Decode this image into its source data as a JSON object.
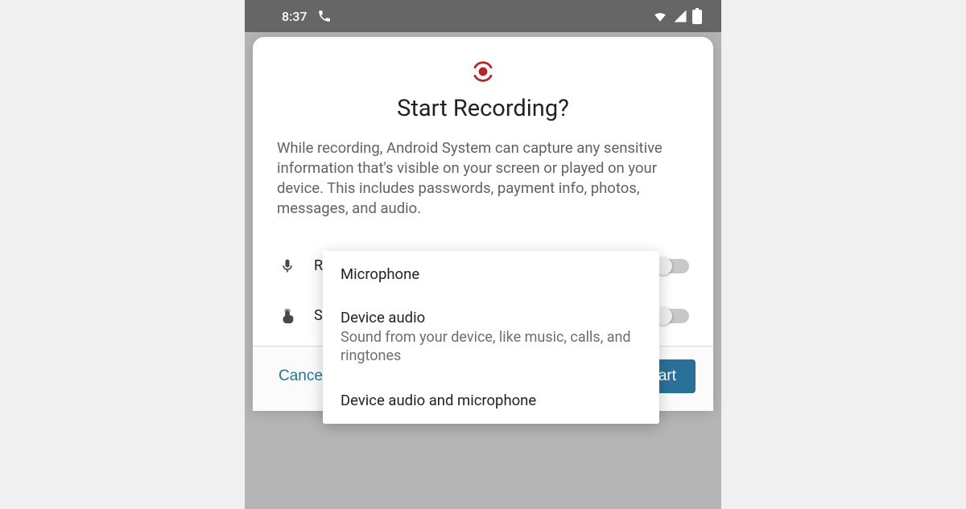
{
  "status_bar": {
    "time": "8:37"
  },
  "dialog": {
    "title": "Start Recording?",
    "description": "While recording, Android System can capture any sensitive information that's visible on your screen or played on your device. This includes passwords, payment info, photos, messages, and audio.",
    "rows": [
      {
        "label": "Record audio"
      },
      {
        "label": "Show touches on screen"
      }
    ],
    "buttons": {
      "cancel": "Cancel",
      "start": "Start"
    }
  },
  "popup": {
    "items": [
      {
        "label": "Microphone",
        "sub": ""
      },
      {
        "label": "Device audio",
        "sub": "Sound from your device, like music, calls, and ringtones"
      },
      {
        "label": "Device audio and microphone",
        "sub": ""
      }
    ]
  }
}
